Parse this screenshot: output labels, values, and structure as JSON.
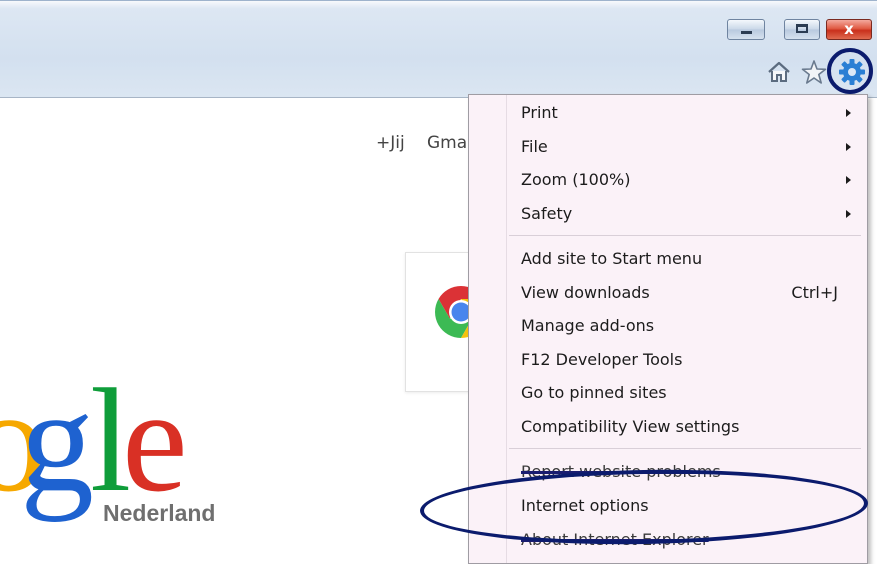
{
  "window_controls": {
    "minimize_icon": "minimize-icon",
    "maximize_icon": "maximize-icon",
    "close_label": "x"
  },
  "toolbar": {
    "icons": [
      "home-icon",
      "star-icon",
      "gear-icon"
    ]
  },
  "google_page": {
    "links": {
      "plus": "+Jij",
      "gmail": "Gma"
    },
    "logo": {
      "letters": [
        "o",
        "g",
        "l",
        "e"
      ],
      "region": "Nederland"
    },
    "chrome_promo_icon": "chrome-icon"
  },
  "menu": {
    "items": [
      {
        "label": "Print",
        "submenu": true
      },
      {
        "label": "File",
        "submenu": true
      },
      {
        "label": "Zoom (100%)",
        "submenu": true
      },
      {
        "label": "Safety",
        "submenu": true
      },
      {
        "label": "Add site to Start menu"
      },
      {
        "label": "View downloads",
        "shortcut": "Ctrl+J"
      },
      {
        "label": "Manage add-ons"
      },
      {
        "label": "F12 Developer Tools"
      },
      {
        "label": "Go to pinned sites"
      },
      {
        "label": "Compatibility View settings"
      },
      {
        "label": "Report website problems"
      },
      {
        "label": "Internet options"
      },
      {
        "label": "About Internet Explorer"
      }
    ]
  },
  "annotations": {
    "color": "#0b1b6d"
  }
}
